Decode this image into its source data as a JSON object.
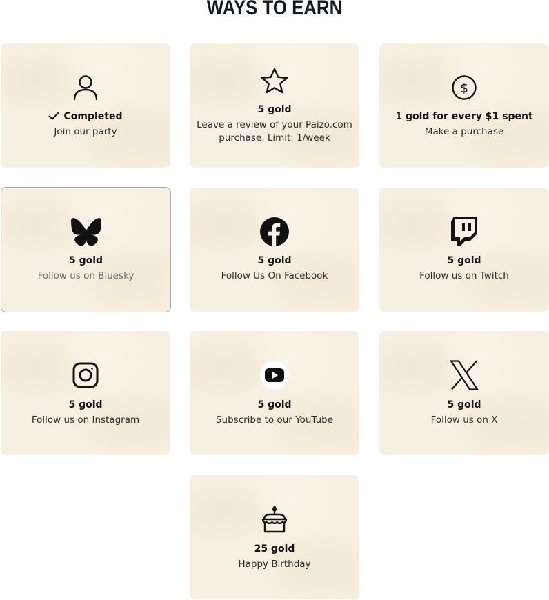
{
  "page": {
    "title": "WAYS TO EARN"
  },
  "cards": [
    {
      "icon": "user-icon",
      "reward": "Completed",
      "description": "Join our party",
      "completed": true
    },
    {
      "icon": "star-icon",
      "reward": "5 gold",
      "description": "Leave a review of your Paizo.com purchase. Limit: 1/week"
    },
    {
      "icon": "dollar-circle-icon",
      "reward": "1 gold for every $1 spent",
      "description": "Make a purchase"
    },
    {
      "icon": "bluesky-icon",
      "reward": "5 gold",
      "description": "Follow us on Bluesky"
    },
    {
      "icon": "facebook-icon",
      "reward": "5 gold",
      "description": "Follow Us On Facebook"
    },
    {
      "icon": "twitch-icon",
      "reward": "5 gold",
      "description": "Follow us on Twitch"
    },
    {
      "icon": "instagram-icon",
      "reward": "5 gold",
      "description": "Follow us on Instagram"
    },
    {
      "icon": "youtube-icon",
      "reward": "5 gold",
      "description": "Subscribe to our YouTube"
    },
    {
      "icon": "x-icon",
      "reward": "5 gold",
      "description": "Follow us on X"
    },
    {
      "icon": "birthday-cake-icon",
      "reward": "25 gold",
      "description": "Happy Birthday"
    }
  ]
}
